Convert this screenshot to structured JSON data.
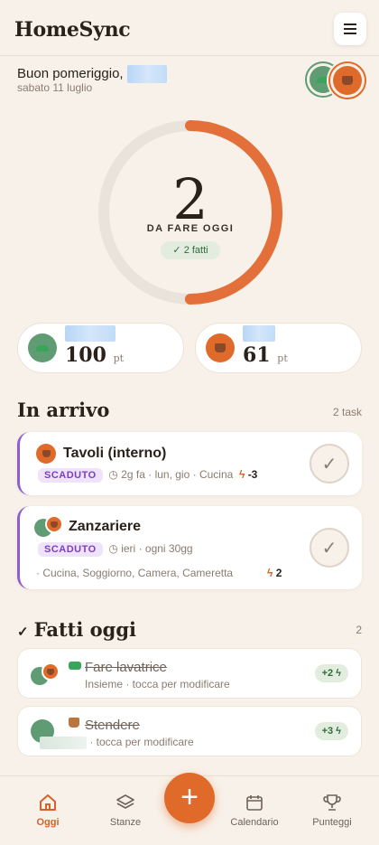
{
  "app": {
    "title": "HomeSync"
  },
  "greeting": {
    "text": "Buon pomeriggio,",
    "date": "sabato 11 luglio"
  },
  "summary": {
    "count": "2",
    "label": "DA FARE OGGI",
    "done": "2 fatti",
    "done_fraction": 0.5
  },
  "scores": [
    {
      "points": "100",
      "unit": "pt"
    },
    {
      "points": "61",
      "unit": "pt"
    }
  ],
  "upcoming": {
    "title": "In arrivo",
    "count": "2 task",
    "tasks": [
      {
        "title": "Tavoli (interno)",
        "status": "SCADUTO",
        "when": "2g fa",
        "schedule": "· lun, gio",
        "room": "· Cucina",
        "points": "-3"
      },
      {
        "title": "Zanzariere",
        "status": "SCADUTO",
        "when": "ieri",
        "schedule": "· ogni 30gg",
        "room": "· Cucina, Soggiorno, Camera, Cameretta",
        "points": "2"
      }
    ]
  },
  "done_today": {
    "title": "Fatti oggi",
    "count": "2",
    "items": [
      {
        "title": "Fare lavatrice",
        "subtitle": "Insieme · tocca per modificare",
        "points": "+2"
      },
      {
        "title": "Stendere",
        "subtitle": "· tocca per modificare",
        "points": "+3"
      }
    ]
  },
  "nav": {
    "today": "Oggi",
    "rooms": "Stanze",
    "calendar": "Calendario",
    "scores": "Punteggi"
  },
  "colors": {
    "accent": "#e06a2a",
    "green": "#5f9b73",
    "late": "#8f5fd1",
    "background": "#f8f1e9"
  },
  "icons": [
    "menu-icon",
    "check-icon",
    "clock-icon",
    "bolt-icon",
    "home-icon",
    "layers-icon",
    "calendar-icon",
    "trophy-icon",
    "plus-icon"
  ]
}
